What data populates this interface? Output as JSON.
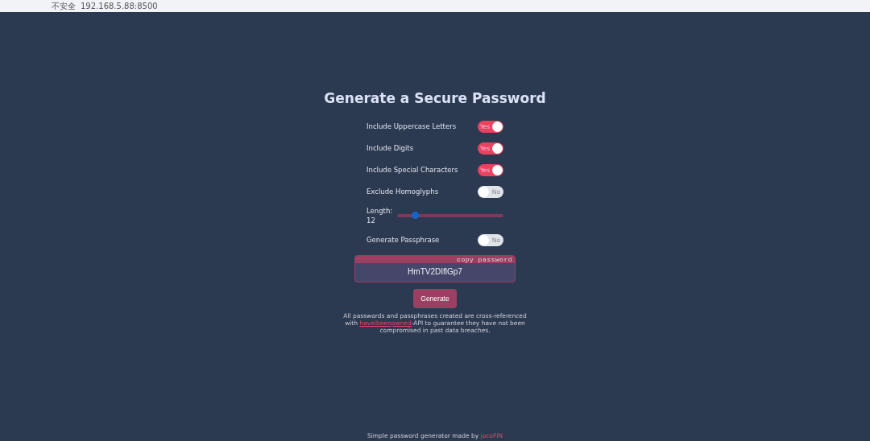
{
  "browser": {
    "security": "不安全",
    "address": "192.168.5.88:8500"
  },
  "title": "Generate a Secure Password",
  "options": [
    {
      "kind": "toggle",
      "label": "Include Uppercase Letters",
      "on": true,
      "state_text": "Yes"
    },
    {
      "kind": "toggle",
      "label": "Include Digits",
      "on": true,
      "state_text": "Yes"
    },
    {
      "kind": "toggle",
      "label": "Include Special Characters",
      "on": true,
      "state_text": "Yes"
    },
    {
      "kind": "toggle",
      "label": "Exclude Homoglyphs",
      "on": false,
      "state_text": "No"
    },
    {
      "kind": "slider",
      "label": "Length:",
      "reading": "12",
      "level": 0.17
    },
    {
      "kind": "toggle",
      "label": "Generate Passphrase",
      "on": false,
      "state_text": "No"
    }
  ],
  "password": {
    "copy_label": "copy password",
    "value": "HmTV2DIflGp7"
  },
  "generate_button": "Generate",
  "note": {
    "before": "All passwords and passphrases created are cross-referenced with ",
    "link": "haveibeenpwned",
    "after": "-API to guarantee they have not been compromised in past data breaches."
  },
  "footer": {
    "text": "Simple password generator made by ",
    "link": "jocoFIN"
  }
}
